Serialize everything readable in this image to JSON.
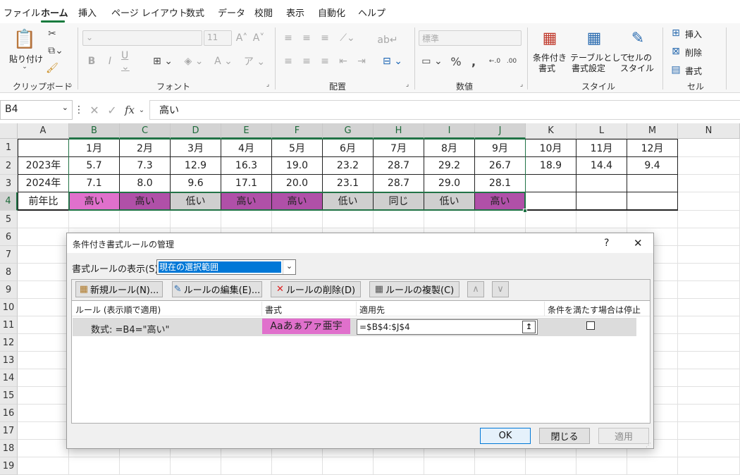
{
  "tabs": [
    "ファイル",
    "ホーム",
    "挿入",
    "ページ レイアウト",
    "数式",
    "データ",
    "校閲",
    "表示",
    "自動化",
    "ヘルプ"
  ],
  "ribbon": {
    "clipboard": {
      "label": "クリップボード",
      "paste": "貼り付け"
    },
    "font": {
      "label": "フォント",
      "size": "11"
    },
    "alignment": {
      "label": "配置"
    },
    "number": {
      "label": "数値",
      "format": "標準"
    },
    "styles": {
      "label": "スタイル",
      "conditional": [
        "条件付き",
        "書式"
      ],
      "table": [
        "テーブルとして",
        "書式設定"
      ],
      "cellstyle": [
        "セルの",
        "スタイル"
      ]
    },
    "cells": {
      "label": "セル",
      "insert": "挿入",
      "delete": "削除",
      "format": "書式"
    }
  },
  "formula_bar": {
    "name_box": "B4",
    "fx": "fx",
    "content": "高い"
  },
  "sheet": {
    "columns": [
      "A",
      "B",
      "C",
      "D",
      "E",
      "F",
      "G",
      "H",
      "I",
      "J",
      "K",
      "L",
      "M",
      "N"
    ],
    "rows": [
      "1",
      "2",
      "3",
      "4",
      "5",
      "6",
      "7",
      "8",
      "9",
      "10",
      "11",
      "12",
      "13",
      "14",
      "15",
      "16",
      "17",
      "18",
      "19"
    ],
    "row1": [
      "",
      "1月",
      "2月",
      "3月",
      "4月",
      "5月",
      "6月",
      "7月",
      "8月",
      "9月",
      "10月",
      "11月",
      "12月"
    ],
    "row2": [
      "2023年",
      "5.7",
      "7.3",
      "12.9",
      "16.3",
      "19.0",
      "23.2",
      "28.7",
      "29.2",
      "26.7",
      "18.9",
      "14.4",
      "9.4"
    ],
    "row3": [
      "2024年",
      "7.1",
      "8.0",
      "9.6",
      "17.1",
      "20.0",
      "23.1",
      "28.7",
      "29.0",
      "28.1",
      "",
      "",
      ""
    ],
    "row4": [
      "前年比",
      "高い",
      "高い",
      "低い",
      "高い",
      "高い",
      "低い",
      "同じ",
      "低い",
      "高い",
      "",
      "",
      ""
    ]
  },
  "colors": {
    "accent": "#217346",
    "high": "#b050a8",
    "high_active": "#e070cc",
    "low": "#cfcfcf",
    "dialog_sel": "#0078d7"
  },
  "dialog": {
    "title": "条件付き書式ルールの管理",
    "help": "?",
    "close": "✕",
    "show_rules_label": "書式ルールの表示(S):",
    "show_rules_value": "現在の選択範囲",
    "toolbar": {
      "new": "新規ルール(N)...",
      "edit": "ルールの編集(E)...",
      "delete": "ルールの削除(D)",
      "duplicate": "ルールの複製(C)"
    },
    "columns": [
      "ルール (表示順で適用)",
      "書式",
      "適用先",
      "条件を満たす場合は停止"
    ],
    "rule": {
      "text": "数式: =B4=\"高い\"",
      "preview": "Aaあぁアァ亜宇",
      "applies_to": "=$B$4:$J$4"
    },
    "buttons": {
      "ok": "OK",
      "close": "閉じる",
      "apply": "適用"
    }
  }
}
